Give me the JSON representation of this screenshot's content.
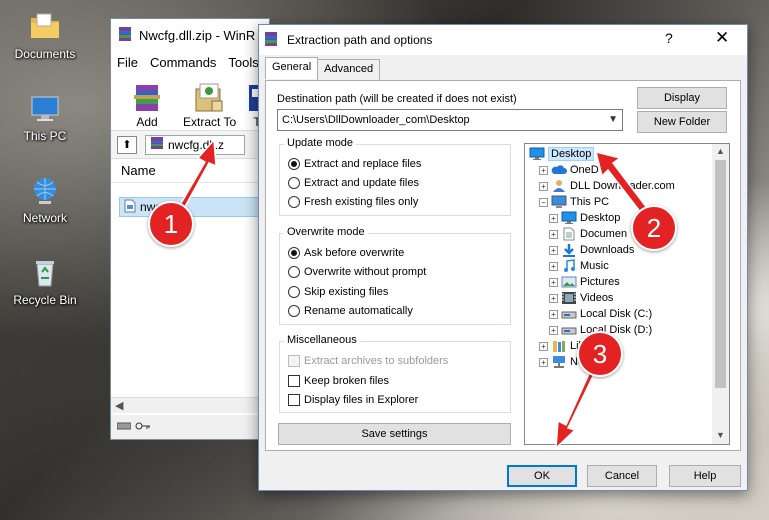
{
  "desktop": {
    "icons": [
      {
        "label": "Documents",
        "icon": "folder-documents-icon"
      },
      {
        "label": "This PC",
        "icon": "computer-icon"
      },
      {
        "label": "Network",
        "icon": "network-icon"
      },
      {
        "label": "Recycle Bin",
        "icon": "recycle-bin-icon"
      }
    ]
  },
  "winrar": {
    "title": "Nwcfg.dll.zip - WinR",
    "menu": [
      "File",
      "Commands",
      "Tools"
    ],
    "toolbar": [
      {
        "label": "Add",
        "icon": "add-archive-icon"
      },
      {
        "label": "Extract To",
        "icon": "extract-to-icon"
      },
      {
        "label": "T",
        "icon": "test-icon"
      }
    ],
    "path": "nwcfg.dll.z",
    "column_name": "Name",
    "selected_file": "nwcfg.dll"
  },
  "dialog": {
    "title": "Extraction path and options",
    "help_glyph": "?",
    "close_glyph": "✕",
    "tabs": [
      "General",
      "Advanced"
    ],
    "destination_label": "Destination path (will be created if does not exist)",
    "destination_value": "C:\\Users\\DllDownloader_com\\Desktop",
    "display_button": "Display",
    "new_folder_button": "New Folder",
    "update_mode": {
      "title": "Update mode",
      "options": [
        "Extract and replace files",
        "Extract and update files",
        "Fresh existing files only"
      ],
      "selected": 0
    },
    "overwrite_mode": {
      "title": "Overwrite mode",
      "options": [
        "Ask before overwrite",
        "Overwrite without prompt",
        "Skip existing files",
        "Rename automatically"
      ],
      "selected": 0
    },
    "miscellaneous": {
      "title": "Miscellaneous",
      "options": [
        "Extract archives to subfolders",
        "Keep broken files",
        "Display files in Explorer"
      ]
    },
    "save_settings_button": "Save settings",
    "ok_button": "OK",
    "cancel_button": "Cancel",
    "help_button": "Help",
    "tree": [
      {
        "label": "Desktop",
        "icon": "desktop-icon",
        "level": 0,
        "expander": "",
        "selected": true
      },
      {
        "label": "OneD",
        "icon": "onedrive-icon",
        "level": 1,
        "expander": "+"
      },
      {
        "label": "DLL Downloader.com",
        "icon": "user-icon",
        "level": 1,
        "expander": "+"
      },
      {
        "label": "This PC",
        "icon": "computer-icon",
        "level": 1,
        "expander": "−"
      },
      {
        "label": "Desktop",
        "icon": "desktop-icon",
        "level": 2,
        "expander": "+"
      },
      {
        "label": "Documen",
        "icon": "documents-icon",
        "level": 2,
        "expander": "+"
      },
      {
        "label": "Downloads",
        "icon": "downloads-icon",
        "level": 2,
        "expander": "+"
      },
      {
        "label": "Music",
        "icon": "music-icon",
        "level": 2,
        "expander": "+"
      },
      {
        "label": "Pictures",
        "icon": "pictures-icon",
        "level": 2,
        "expander": "+"
      },
      {
        "label": "Videos",
        "icon": "videos-icon",
        "level": 2,
        "expander": "+"
      },
      {
        "label": "Local Disk (C:)",
        "icon": "drive-icon",
        "level": 2,
        "expander": "+"
      },
      {
        "label": "Local Disk (D:)",
        "icon": "drive-icon",
        "level": 2,
        "expander": "+"
      },
      {
        "label": "Libr",
        "icon": "libraries-icon",
        "level": 1,
        "expander": "+"
      },
      {
        "label": "Net",
        "icon": "network-icon",
        "level": 1,
        "expander": "+"
      }
    ]
  },
  "annotations": {
    "badges": [
      "1",
      "2",
      "3"
    ],
    "color": "#e32224"
  }
}
